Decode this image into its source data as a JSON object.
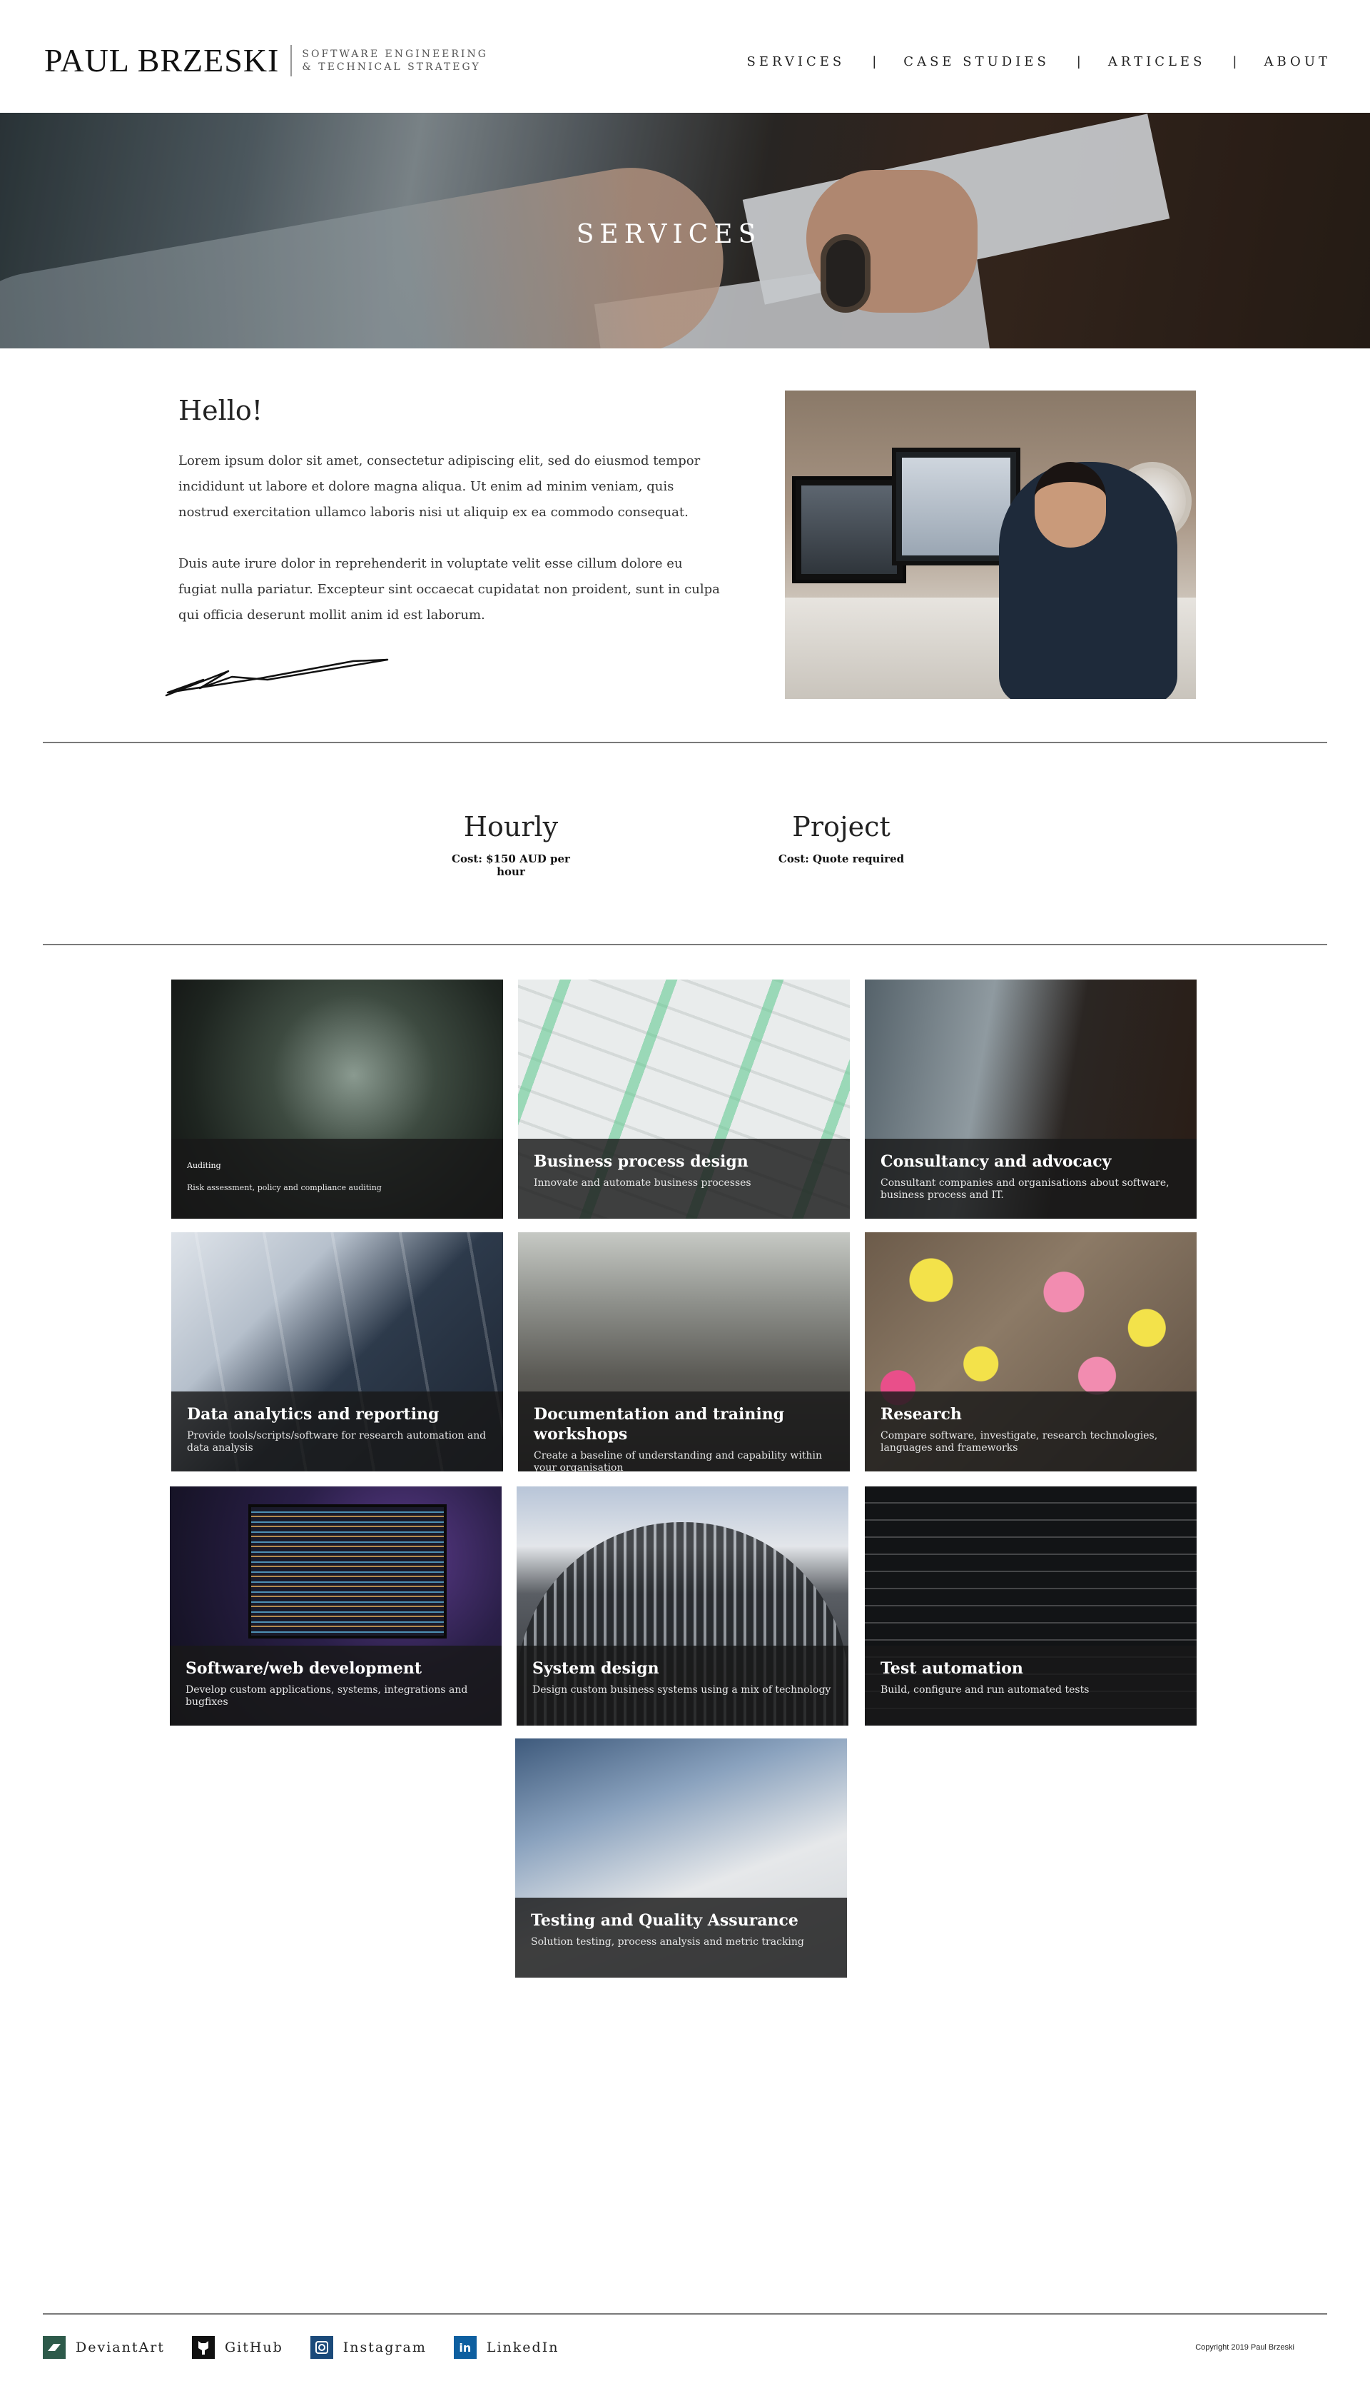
{
  "header": {
    "brand_name": "PAUL BRZESKI",
    "tagline_line1": "SOFTWARE ENGINEERING",
    "tagline_line2": "& TECHNICAL STRATEGY",
    "nav": [
      {
        "label": "SERVICES"
      },
      {
        "label": "CASE STUDIES"
      },
      {
        "label": "ARTICLES"
      },
      {
        "label": "ABOUT"
      }
    ],
    "nav_separator": "|"
  },
  "hero": {
    "title": "SERVICES"
  },
  "intro": {
    "heading": "Hello!",
    "paragraph1": "Lorem ipsum dolor sit amet, consectetur adipiscing elit, sed do eiusmod tempor incididunt ut labore et dolore magna aliqua. Ut enim ad minim veniam, quis nostrud exercitation ullamco laboris nisi ut aliquip ex ea commodo consequat.",
    "paragraph2": "Duis aute irure dolor in reprehenderit in voluptate velit esse cillum dolore eu fugiat nulla pariatur. Excepteur sint occaecat cupidatat non proident, sunt in culpa qui officia deserunt mollit anim id est laborum."
  },
  "pricing": [
    {
      "title": "Hourly",
      "cost": "Cost: $150 AUD per hour"
    },
    {
      "title": "Project",
      "cost": "Cost: Quote required"
    }
  ],
  "services": [
    {
      "title": "Auditing",
      "description": "Risk assessment, policy and compliance auditing"
    },
    {
      "title": "Business process design",
      "description": "Innovate and automate business processes"
    },
    {
      "title": "Consultancy and advocacy",
      "description": "Consultant companies and organisations about software, business process and IT."
    },
    {
      "title": "Data analytics and reporting",
      "description": "Provide tools/scripts/software for research automation and data analysis"
    },
    {
      "title": "Documentation and training workshops",
      "description": "Create a baseline of understanding and capability within your organisation"
    },
    {
      "title": "Research",
      "description": "Compare software, investigate, research technologies, languages and frameworks"
    },
    {
      "title": "Software/web development",
      "description": "Develop custom applications, systems, integrations and bugfixes"
    },
    {
      "title": "System design",
      "description": "Design custom business systems using a mix of technology"
    },
    {
      "title": "Test automation",
      "description": "Build, configure and run automated tests"
    },
    {
      "title": "Testing and Quality Assurance",
      "description": "Solution testing, process analysis and metric tracking"
    }
  ],
  "footer": {
    "social": [
      {
        "label": "DeviantArt",
        "icon": "deviantart-icon"
      },
      {
        "label": "GitHub",
        "icon": "github-icon"
      },
      {
        "label": "Instagram",
        "icon": "instagram-icon"
      },
      {
        "label": "LinkedIn",
        "icon": "linkedin-icon"
      }
    ],
    "copyright": "Copyright 2019 Paul Brzeski"
  }
}
